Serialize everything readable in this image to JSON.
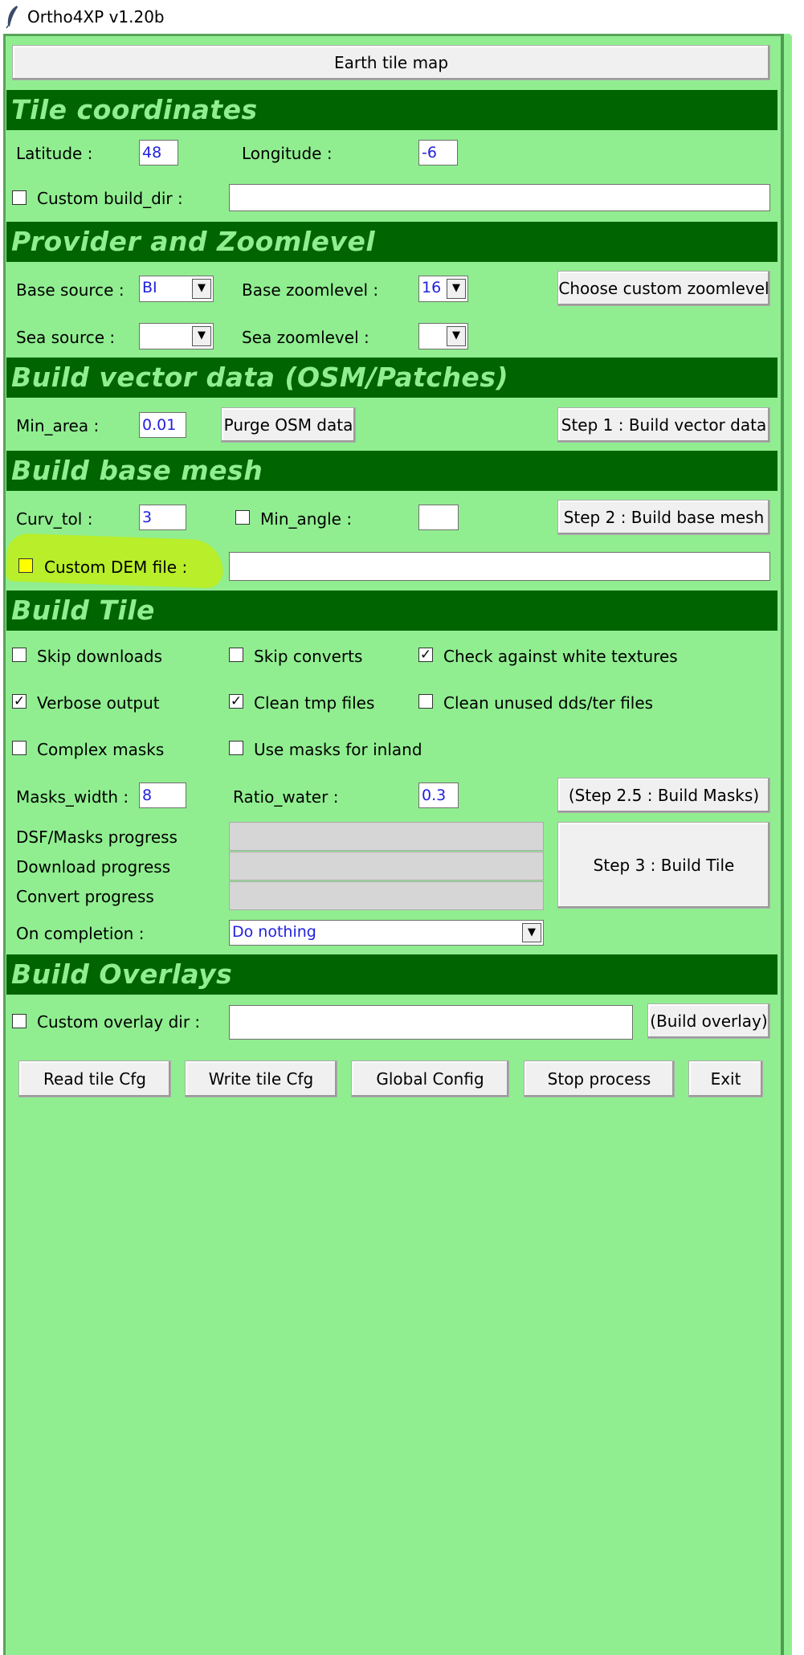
{
  "window": {
    "title": "Ortho4XP  v1.20b",
    "icon": "feather-icon"
  },
  "earth_button": "Earth tile map",
  "sections": {
    "tile_coordinates": "Tile coordinates",
    "provider": "Provider and Zoomlevel",
    "vector": "Build vector data (OSM/Patches)",
    "mesh": "Build base mesh",
    "tile": "Build Tile",
    "overlays": "Build Overlays"
  },
  "tile_coordinates": {
    "latitude_label": "Latitude :",
    "latitude_value": "48",
    "longitude_label": "Longitude :",
    "longitude_value": "-6",
    "custom_build_dir_label": "Custom build_dir :",
    "custom_build_dir_value": ""
  },
  "provider": {
    "base_source_label": "Base source :",
    "base_source_value": "BI",
    "base_zoom_label": "Base zoomlevel :",
    "base_zoom_value": "16",
    "custom_zoom_button": "Choose custom zoomlevel",
    "sea_source_label": "Sea source :",
    "sea_source_value": "",
    "sea_zoom_label": "Sea zoomlevel :",
    "sea_zoom_value": ""
  },
  "vector": {
    "min_area_label": "Min_area :",
    "min_area_value": "0.01",
    "purge_button": "Purge OSM data",
    "step1_button": "Step 1 : Build vector data"
  },
  "mesh": {
    "curv_tol_label": "Curv_tol :",
    "curv_tol_value": "3",
    "min_angle_label": "Min_angle :",
    "min_angle_value": "",
    "step2_button": "Step 2 : Build base mesh",
    "custom_dem_label": "Custom DEM file :",
    "custom_dem_value": ""
  },
  "tile": {
    "options": [
      {
        "label": "Skip downloads",
        "checked": false
      },
      {
        "label": "Skip converts",
        "checked": false
      },
      {
        "label": "Check against white textures",
        "checked": true
      },
      {
        "label": "Verbose output",
        "checked": true
      },
      {
        "label": "Clean tmp files",
        "checked": true
      },
      {
        "label": "Clean unused dds/ter files",
        "checked": false
      },
      {
        "label": "Complex masks",
        "checked": false
      },
      {
        "label": "Use masks for inland",
        "checked": false
      }
    ],
    "masks_width_label": "Masks_width :",
    "masks_width_value": "8",
    "ratio_water_label": "Ratio_water :",
    "ratio_water_value": "0.3",
    "step25_button": "(Step 2.5 : Build Masks)",
    "progress": [
      {
        "label": "DSF/Masks progress",
        "value": 0
      },
      {
        "label": "Download progress",
        "value": 0
      },
      {
        "label": "Convert progress",
        "value": 0
      }
    ],
    "step3_button": "Step 3 : Build Tile",
    "on_completion_label": "On completion :",
    "on_completion_value": "Do nothing"
  },
  "overlays": {
    "custom_overlay_label": "Custom overlay dir :",
    "custom_overlay_value": "",
    "build_overlay_button": "(Build overlay)"
  },
  "bottom_buttons": {
    "read": "Read tile Cfg",
    "write": "Write tile Cfg",
    "global": "Global Config",
    "stop": "Stop process",
    "exit": "Exit"
  },
  "colors": {
    "panel": "#90ee90",
    "header": "#006400",
    "header_text": "#90ee90",
    "entry_text": "#2222dd",
    "highlight": "#b8ee2a"
  }
}
